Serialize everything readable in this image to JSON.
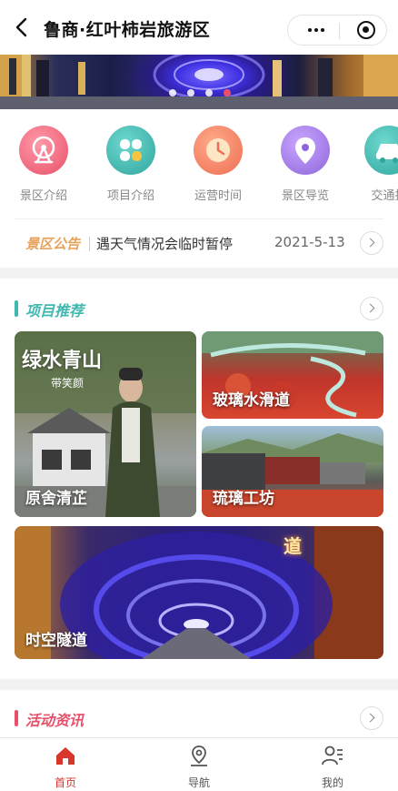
{
  "header": {
    "title": "鲁商·红叶柿岩旅游区"
  },
  "banner": {
    "active_dot": 3
  },
  "quick_nav": [
    {
      "label": "景区介绍",
      "icon": "ferris-wheel-icon",
      "color": "#ec6c7a"
    },
    {
      "label": "项目介绍",
      "icon": "clover-icon",
      "color": "#3fb8b0"
    },
    {
      "label": "运营时间",
      "icon": "clock-icon",
      "color": "#f07a5f"
    },
    {
      "label": "景区导览",
      "icon": "map-pin-icon",
      "color": "#a07ae0"
    },
    {
      "label": "交通指",
      "icon": "car-icon",
      "color": "#3fb8b0"
    }
  ],
  "notice": {
    "tag": "景区公告",
    "text": "遇天气情况会临时暂停",
    "date": "2021-5-13"
  },
  "projects": {
    "title": "项目推荐",
    "accent": "#3fb8b0",
    "items": [
      {
        "label": "原舍清芷",
        "overlay": "绿水青山",
        "overlay_sub": "带笑颜"
      },
      {
        "label": "玻璃水滑道"
      },
      {
        "label": "琉璃工坊"
      },
      {
        "label": "时空隧道",
        "sign": "道"
      }
    ]
  },
  "activities": {
    "title": "活动资讯",
    "accent": "#e8506a"
  },
  "tabbar": {
    "items": [
      {
        "label": "首页",
        "icon": "home-icon",
        "active": true
      },
      {
        "label": "导航",
        "icon": "location-icon",
        "active": false
      },
      {
        "label": "我的",
        "icon": "user-list-icon",
        "active": false
      }
    ],
    "active_color": "#d9362b",
    "inactive_color": "#555555"
  }
}
